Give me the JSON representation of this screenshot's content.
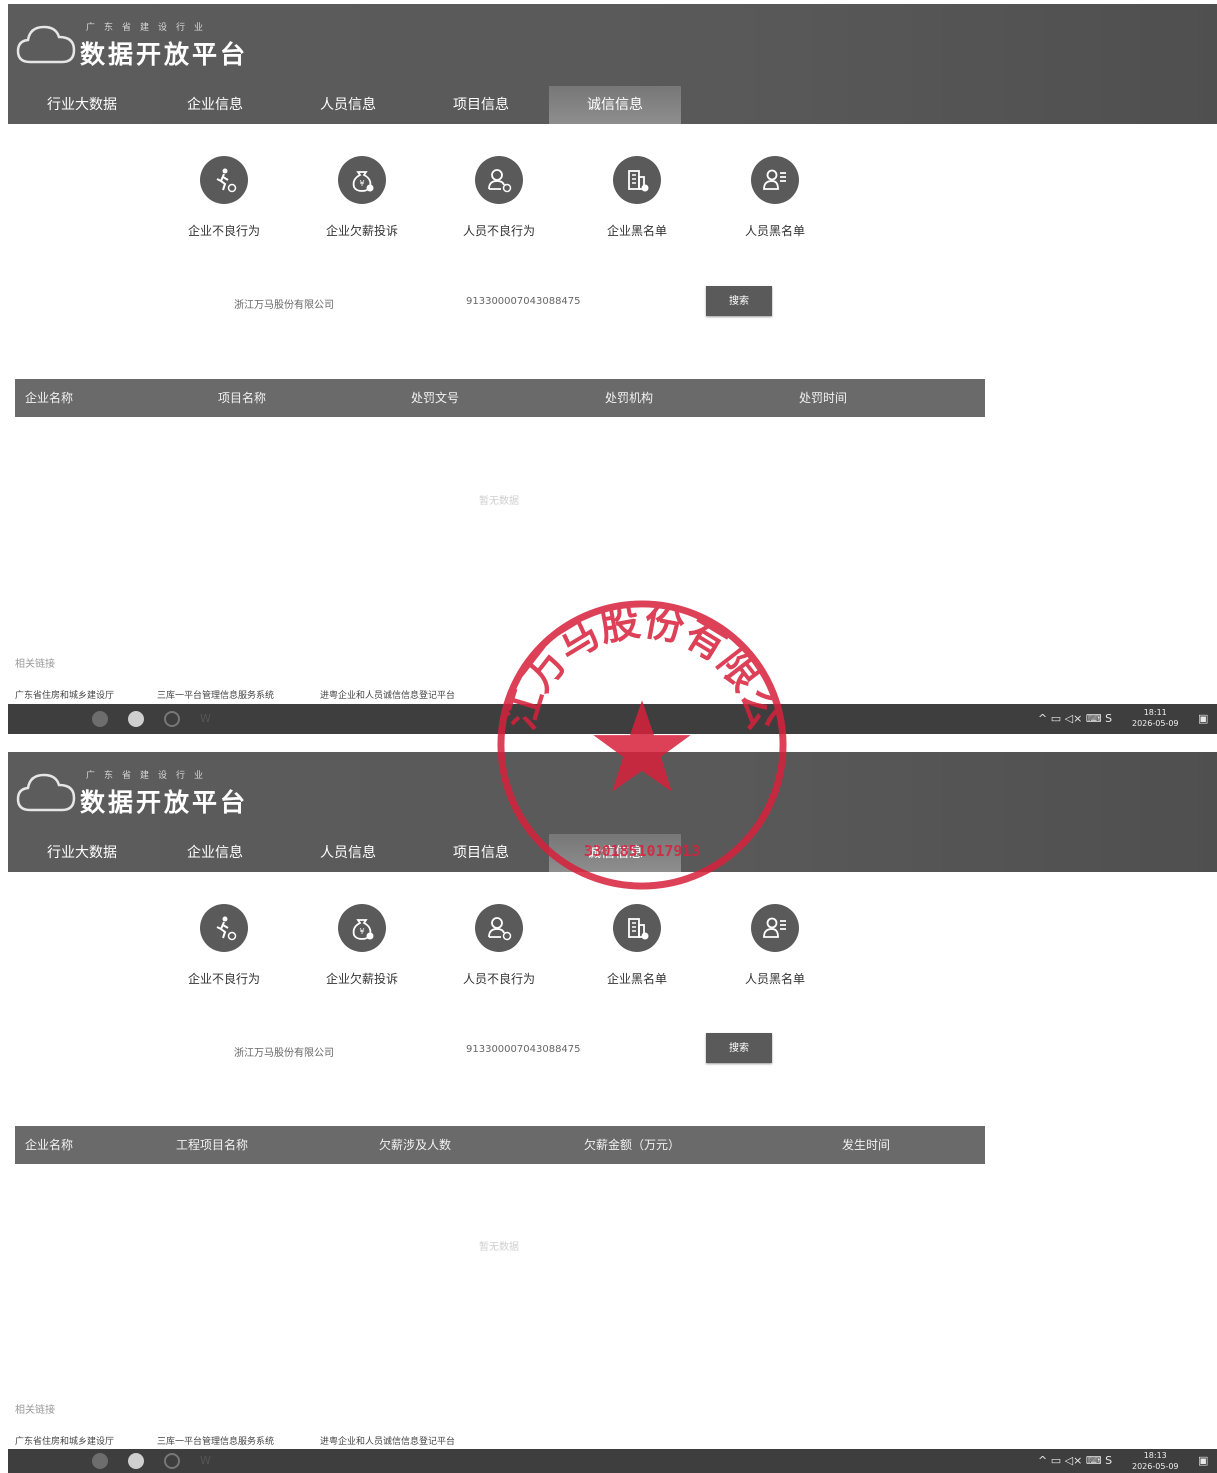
{
  "shots": [
    {
      "header": {
        "logo_sub": "广东省建设行业",
        "logo_main": "数据开放平台",
        "nav": [
          "行业大数据",
          "企业信息",
          "人员信息",
          "项目信息",
          "诚信信息"
        ],
        "active_nav": "诚信信息"
      },
      "categories": [
        "企业不良行为",
        "企业欠薪投诉",
        "人员不良行为",
        "企业黑名单",
        "人员黑名单"
      ],
      "search": {
        "company": "浙江万马股份有限公司",
        "credit_code": "913300007043088475",
        "button": "搜索"
      },
      "table": {
        "columns": [
          "企业名称",
          "项目名称",
          "处罚文号",
          "处罚机构",
          "处罚时间"
        ],
        "empty_text": "暂无数据"
      },
      "footer": {
        "title": "相关链接",
        "links": [
          "广东省住房和城乡建设厅",
          "三库一平台管理信息服务系统",
          "进粤企业和人员诚信信息登记平台"
        ]
      },
      "taskbar": {
        "time": "18:11",
        "date": "2026-05-09"
      }
    },
    {
      "header": {
        "logo_sub": "广东省建设行业",
        "logo_main": "数据开放平台",
        "nav": [
          "行业大数据",
          "企业信息",
          "人员信息",
          "项目信息",
          "诚信信息"
        ],
        "active_nav": "诚信信息"
      },
      "categories": [
        "企业不良行为",
        "企业欠薪投诉",
        "人员不良行为",
        "企业黑名单",
        "人员黑名单"
      ],
      "search": {
        "company": "浙江万马股份有限公司",
        "credit_code": "913300007043088475",
        "button": "搜索"
      },
      "table": {
        "columns": [
          "企业名称",
          "工程项目名称",
          "欠薪涉及人数",
          "欠薪金额（万元）",
          "发生时间"
        ],
        "empty_text": "暂无数据"
      },
      "footer": {
        "title": "相关链接",
        "links": [
          "广东省住房和城乡建设厅",
          "三库一平台管理信息服务系统",
          "进粤企业和人员诚信信息登记平台"
        ]
      },
      "taskbar": {
        "time": "18:13",
        "date": "2026-05-09"
      }
    }
  ],
  "stamp": {
    "text": "浙江万马股份有限公司",
    "code": "3301851017913",
    "color": "#d8213c"
  },
  "colors": {
    "header_bg": "#595959",
    "icon_circle": "#5a5a5a",
    "table_head": "#6a6a6a",
    "taskbar": "#3e3e3e"
  }
}
